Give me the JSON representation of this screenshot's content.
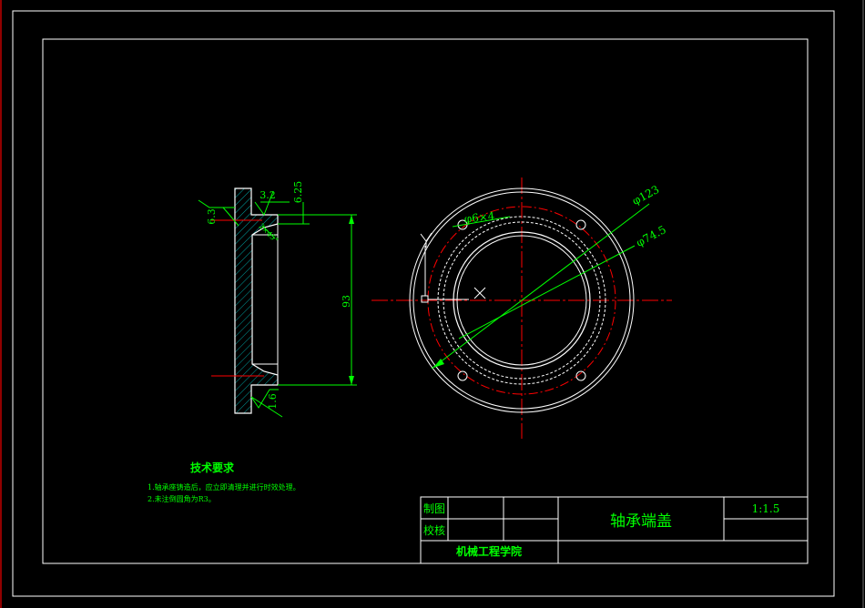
{
  "colors": {
    "background": "#000000",
    "frame": "#ffffff",
    "geometry": "#ffffff",
    "dimension": "#00ff00",
    "centerline": "#ff0000",
    "hatch": "#00ffff",
    "text": "#00ff00"
  },
  "section_view": {
    "roughness_left": "6.3",
    "roughness_top": "3.2",
    "dim_top": "6.25",
    "dim_chamfer": "2×45°",
    "dim_height": "93",
    "roughness_bottom": "1.6"
  },
  "front_view": {
    "dim_outer": "φ123",
    "dim_bolt_circle": "φ74.5",
    "dim_holes": "φ6×4"
  },
  "tech_requirements": {
    "title": "技术要求",
    "item1": "1.轴承座铸造后，应立即清理并进行时效处理。",
    "item2": "2.未注倒圆角为R3。"
  },
  "title_block": {
    "drawn_by_label": "制图",
    "checked_by_label": "校核",
    "part_name": "轴承端盖",
    "scale": "1:1.5",
    "school": "机械工程学院"
  }
}
